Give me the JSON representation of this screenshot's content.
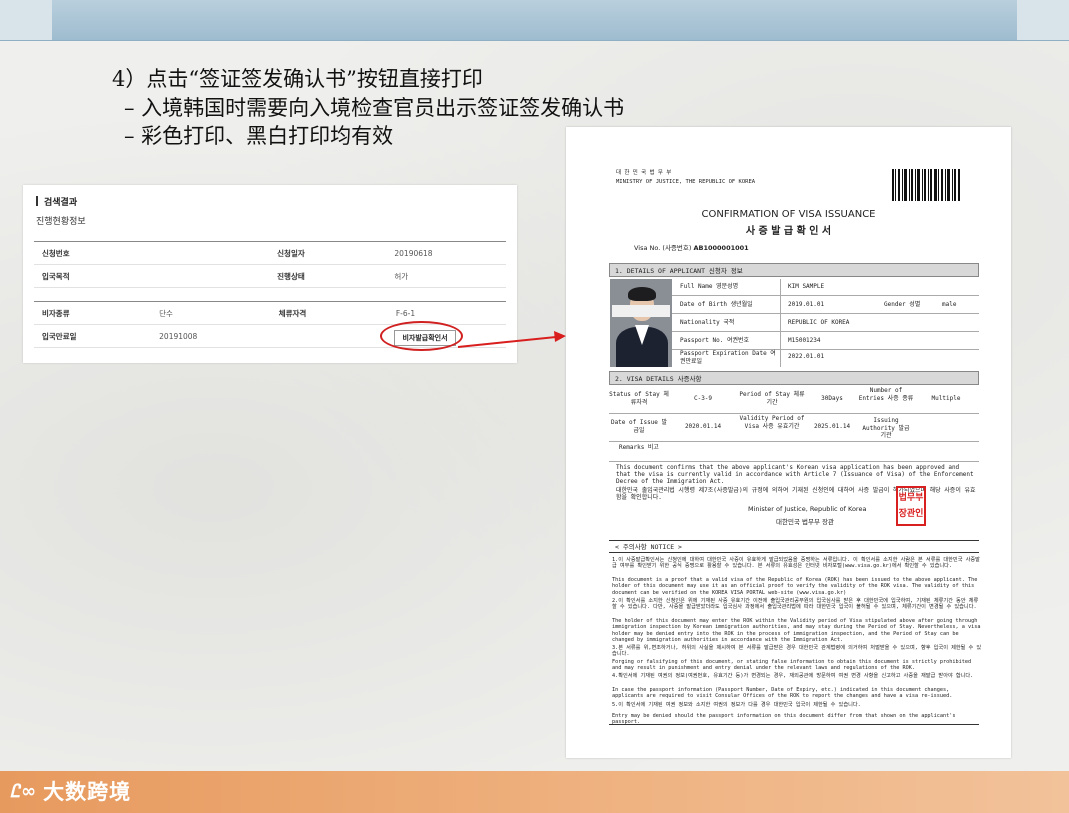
{
  "slide": {
    "heading": "4）点击“签证签发确认书”按钮直接打印",
    "bullets": [
      "– 入境韩国时需要向入境检查官员出示签证签发确认书",
      "– 彩色打印、黑白打印均有效"
    ],
    "logo_mark": "Ꮭ∞",
    "logo_text": "大数跨境"
  },
  "search_panel": {
    "title": "검색결과",
    "subtitle": "진행현황정보",
    "table1": [
      {
        "label": "신청번호",
        "value": "",
        "label2": "신청일자",
        "value2": "20190618"
      },
      {
        "label": "입국목적",
        "value": "",
        "label2": "진행상태",
        "value2": "허가"
      }
    ],
    "table2": [
      {
        "label": "비자종류",
        "value": "단수",
        "label2": "체류자격",
        "value2": "F-6-1"
      },
      {
        "label": "입국만료일",
        "value": "20191008",
        "label2": "",
        "value2": ""
      }
    ],
    "visa_button": "비자발급확인서"
  },
  "document": {
    "ministry_ko": "대 한 민 국   법 무 부",
    "ministry_en": "MINISTRY OF JUSTICE, THE REPUBLIC OF KOREA",
    "title_en": "CONFIRMATION OF VISA ISSUANCE",
    "title_ko": "사 증 발 급 확 인 서",
    "visa_no_label": "Visa No. (사증번호)",
    "visa_no": "AB1000001001",
    "section1": "1. DETAILS OF APPLICANT 신청자 정보",
    "applicant": [
      {
        "label": "Full Name 영문성명",
        "value": "KIM SAMPLE"
      },
      {
        "label": "Date of Birth 생년월일",
        "value": "2019.01.01"
      },
      {
        "label": "Nationality  국적",
        "value": "REPUBLIC OF KOREA"
      },
      {
        "label": "Passport No. 여권번호",
        "value": "M15001234"
      },
      {
        "label": "Passport Expiration Date 여권만료일",
        "value": "2022.01.01"
      }
    ],
    "gender_label": "Gender 성별",
    "gender": "male",
    "section2": "2. VISA DETAILS 사증사항",
    "visa": {
      "status_label": "Status of Stay 체류자격",
      "status": "C-3-9",
      "period_label": "Period of Stay 체류기간",
      "period": "30Days",
      "entries_label": "Number of Entries 사증 종류",
      "entries": "Multiple",
      "issue_label": "Date of Issue 발급일",
      "issue": "2020.01.14",
      "validity_label": "Validity Period of Visa 사증 유효기간",
      "validity": "2025.01.14",
      "authority_label": "Issuing Authority 발급 기관",
      "authority": "",
      "remarks_label": "Remarks 비고",
      "remarks": ""
    },
    "confirm_en": "This document confirms that the above applicant's Korean visa application has been approved and that the visa is currently valid in accordance with Article 7 (Issuance of Visa) of the Enforcement Decree of the Immigration Act.",
    "confirm_ko": "대한민국 출입국관리법 시행령 제7조(사증발급)의 규정에 의하여 기재된 신청인에 대하여 사증 발급이 허가되었으며 해당 사증이 유효함을 확인합니다.",
    "sig_en": "Minister of Justice, Republic of Korea",
    "sig_ko": "대한민국 법무부 장관",
    "seal_text": "법무부장관인",
    "notice_title": "< 주의사항 NOTICE >",
    "notes": [
      "1.이 사증발급확인서는 신청인에 대하여 대한민국 사증이 유효하게 발급되었음을 증명하는 서류입니다. 이 확인서를 소지한 사람은 본 서류를 대한민국 사증발급 여부를 확인받기 위한 공식 증명으로 활용할 수 있습니다. 본 서류의 유효성은 인터넷 비자포털(www.visa.go.kr)에서 확인할 수 있습니다.",
      "This document is a proof that a valid visa of the Republic of Korea (ROK) has been issued to the above applicant. The holder of this document may use it as an official proof to verify the validity of the ROK visa. The validity of this document can be verified on the KOREA VISA PORTAL web-site (www.visa.go.kr)",
      "2.이 확인서를 소지한 신청인은 위에 기재된 사증 유효기간 이전에 출입국관리공무원의 입국심사를 받은 후 대한민국에 입국하여, 기재된 체류기간 동안 체류할 수 있습니다. 다만, 사증을 발급받았더라도 입국심사 과정에서 출입국관리법에 따라 대한민국 입국이 불허될 수 있으며, 체류기간이 변경될 수 있습니다.",
      "The holder of this document may enter the ROK within the Validity period of Visa stipulated above after going through immigration inspection by Korean immigration authorities, and may stay during the Period of Stay. Nevertheless, a visa holder may be denied entry into the ROK in the process of immigration inspection, and the Period of Stay can be changed by immigration authorities in accordance with the Immigration Act.",
      "3.본 서류를 위,변조하거나, 허위의 사실을 제시하여 본 서류를 발급받은 경우 대한민국 관계법령에 의거하여 처벌받을 수 있으며, 향후 입국이 제한될 수 있습니다.",
      "Forging or falsifying of this document, or stating false information to obtain this document is strictly prohibited and may result in punishment and entry denial under the relevant laws and regulations of the ROK.",
      "4.확인서에 기재된 여권의 정보(여권번호, 유효기간 등)가 변경되는 경우, 재외공관에 방문하여 여권 변경 사항을 신고하고 사증을 재발급 받아야 합니다.",
      "In case the passport information (Passport Number, Date of Expiry, etc.) indicated in this document changes, applicants are required to visit Consular Offices of the ROK to report the changes and have a visa re-issued.",
      "5.이 확인서에 기재된 여권 정보와 소지한 여권의 정보가 다를 경우 대한민국 입국이 제한될 수 있습니다.",
      "Entry may be denied should the passport information on this document differ from that shown on the applicant's passport."
    ]
  }
}
